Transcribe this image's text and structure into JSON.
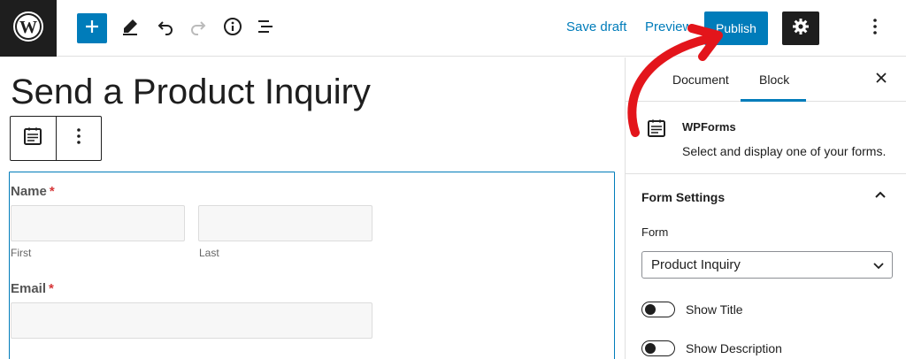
{
  "topbar": {
    "save_draft": "Save draft",
    "preview": "Preview",
    "publish": "Publish"
  },
  "editor": {
    "post_title": "Send a Product Inquiry",
    "form": {
      "name_label": "Name",
      "required_mark": "*",
      "first_sublabel": "First",
      "last_sublabel": "Last",
      "email_label": "Email"
    }
  },
  "sidebar": {
    "tabs": [
      "Document",
      "Block"
    ],
    "active_tab": "Block",
    "block_name": "WPForms",
    "block_description": "Select and display one of your forms.",
    "panel_title": "Form Settings",
    "form_label": "Form",
    "form_selected": "Product Inquiry",
    "toggles": [
      {
        "label": "Show Title",
        "on": false
      },
      {
        "label": "Show Description",
        "on": false
      }
    ]
  },
  "colors": {
    "accent": "#007cba",
    "dark": "#1e1e1e",
    "annotation": "#e3151b",
    "required": "#d63638"
  },
  "icons": [
    "wordpress-icon",
    "plus-icon",
    "pencil-icon",
    "undo-icon",
    "redo-icon",
    "info-icon",
    "list-view-icon",
    "gear-icon",
    "more-vertical-icon",
    "close-icon",
    "wpforms-icon",
    "chevron-up-icon",
    "chevron-down-icon",
    "arrow-annotation-icon"
  ]
}
